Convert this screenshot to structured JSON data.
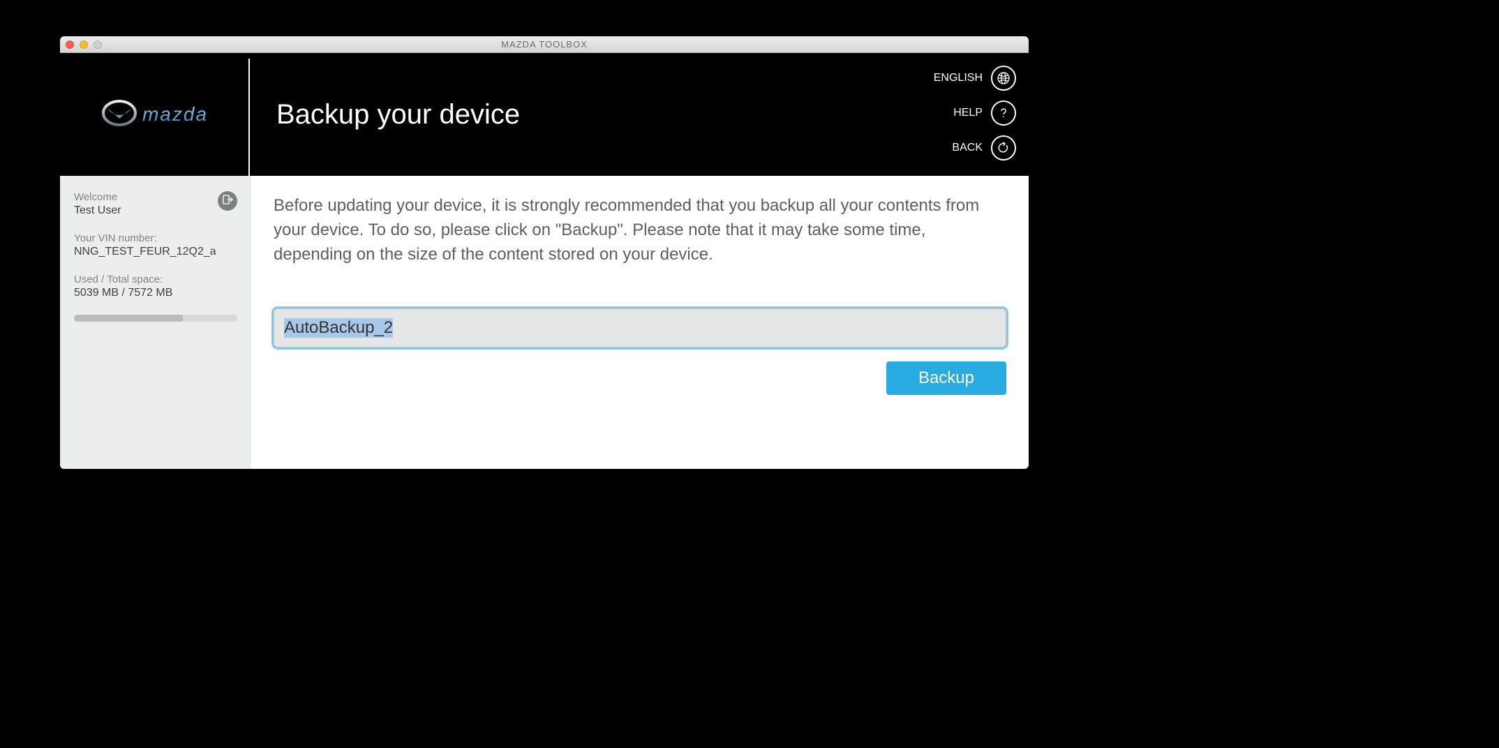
{
  "window": {
    "title": "MAZDA TOOLBOX"
  },
  "brand": {
    "name": "mazda"
  },
  "header": {
    "page_title": "Backup your device",
    "language_label": "ENGLISH",
    "help_label": "HELP",
    "back_label": "BACK"
  },
  "sidebar": {
    "welcome_label": "Welcome",
    "user_name": "Test User",
    "vin_label": "Your VIN number:",
    "vin_value": "NNG_TEST_FEUR_12Q2_a",
    "space_label": "Used / Total space:",
    "space_value": "5039 MB / 7572 MB",
    "space_used_mb": 5039,
    "space_total_mb": 7572
  },
  "main": {
    "description": "Before updating your device, it is strongly recommended that you backup all your contents from your device. To do so, please click on \"Backup\". Please note that it may take some time, depending on the size of the content stored on your device.",
    "backup_name_value": "AutoBackup_2",
    "backup_button_label": "Backup"
  },
  "colors": {
    "primary": "#29abe2",
    "header_bg": "#000000",
    "sidebar_bg": "#eceded"
  }
}
